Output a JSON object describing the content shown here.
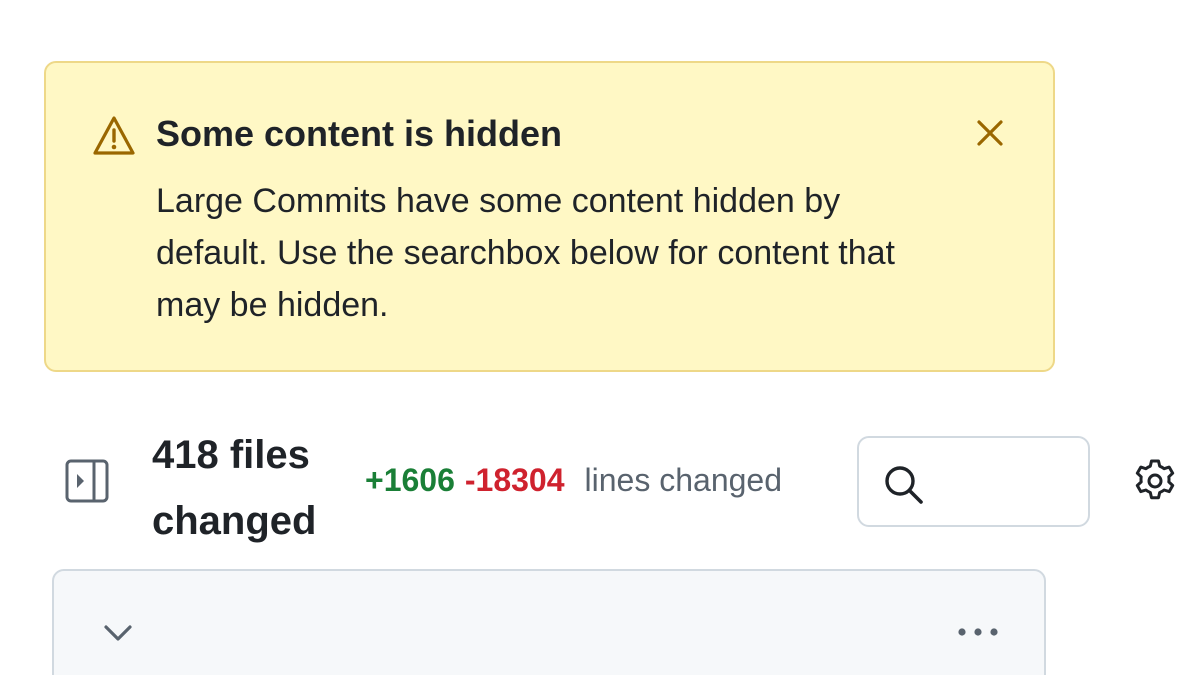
{
  "banner": {
    "icon": "alert-triangle-icon",
    "title": "Some content is hidden",
    "body": "Large Commits have some content hidden by default. Use the searchbox below for content that may be hidden.",
    "close_icon": "close-icon",
    "bg_color": "#fff8c5",
    "border_color": "#eed888",
    "icon_color": "#9a6700"
  },
  "toolbar": {
    "sidebar_toggle_icon": "sidebar-expand-icon",
    "files_changed": "418 files changed",
    "additions": "+1606",
    "deletions": "-18304",
    "lines_label": "lines changed",
    "search": {
      "icon": "search-icon",
      "value": "",
      "placeholder": ""
    },
    "settings_icon": "gear-icon",
    "addition_color": "#1a7f37",
    "deletion_color": "#cf222e"
  },
  "file_card": {
    "expand_icon": "chevron-down-icon",
    "menu_icon": "kebab-horizontal-icon"
  }
}
